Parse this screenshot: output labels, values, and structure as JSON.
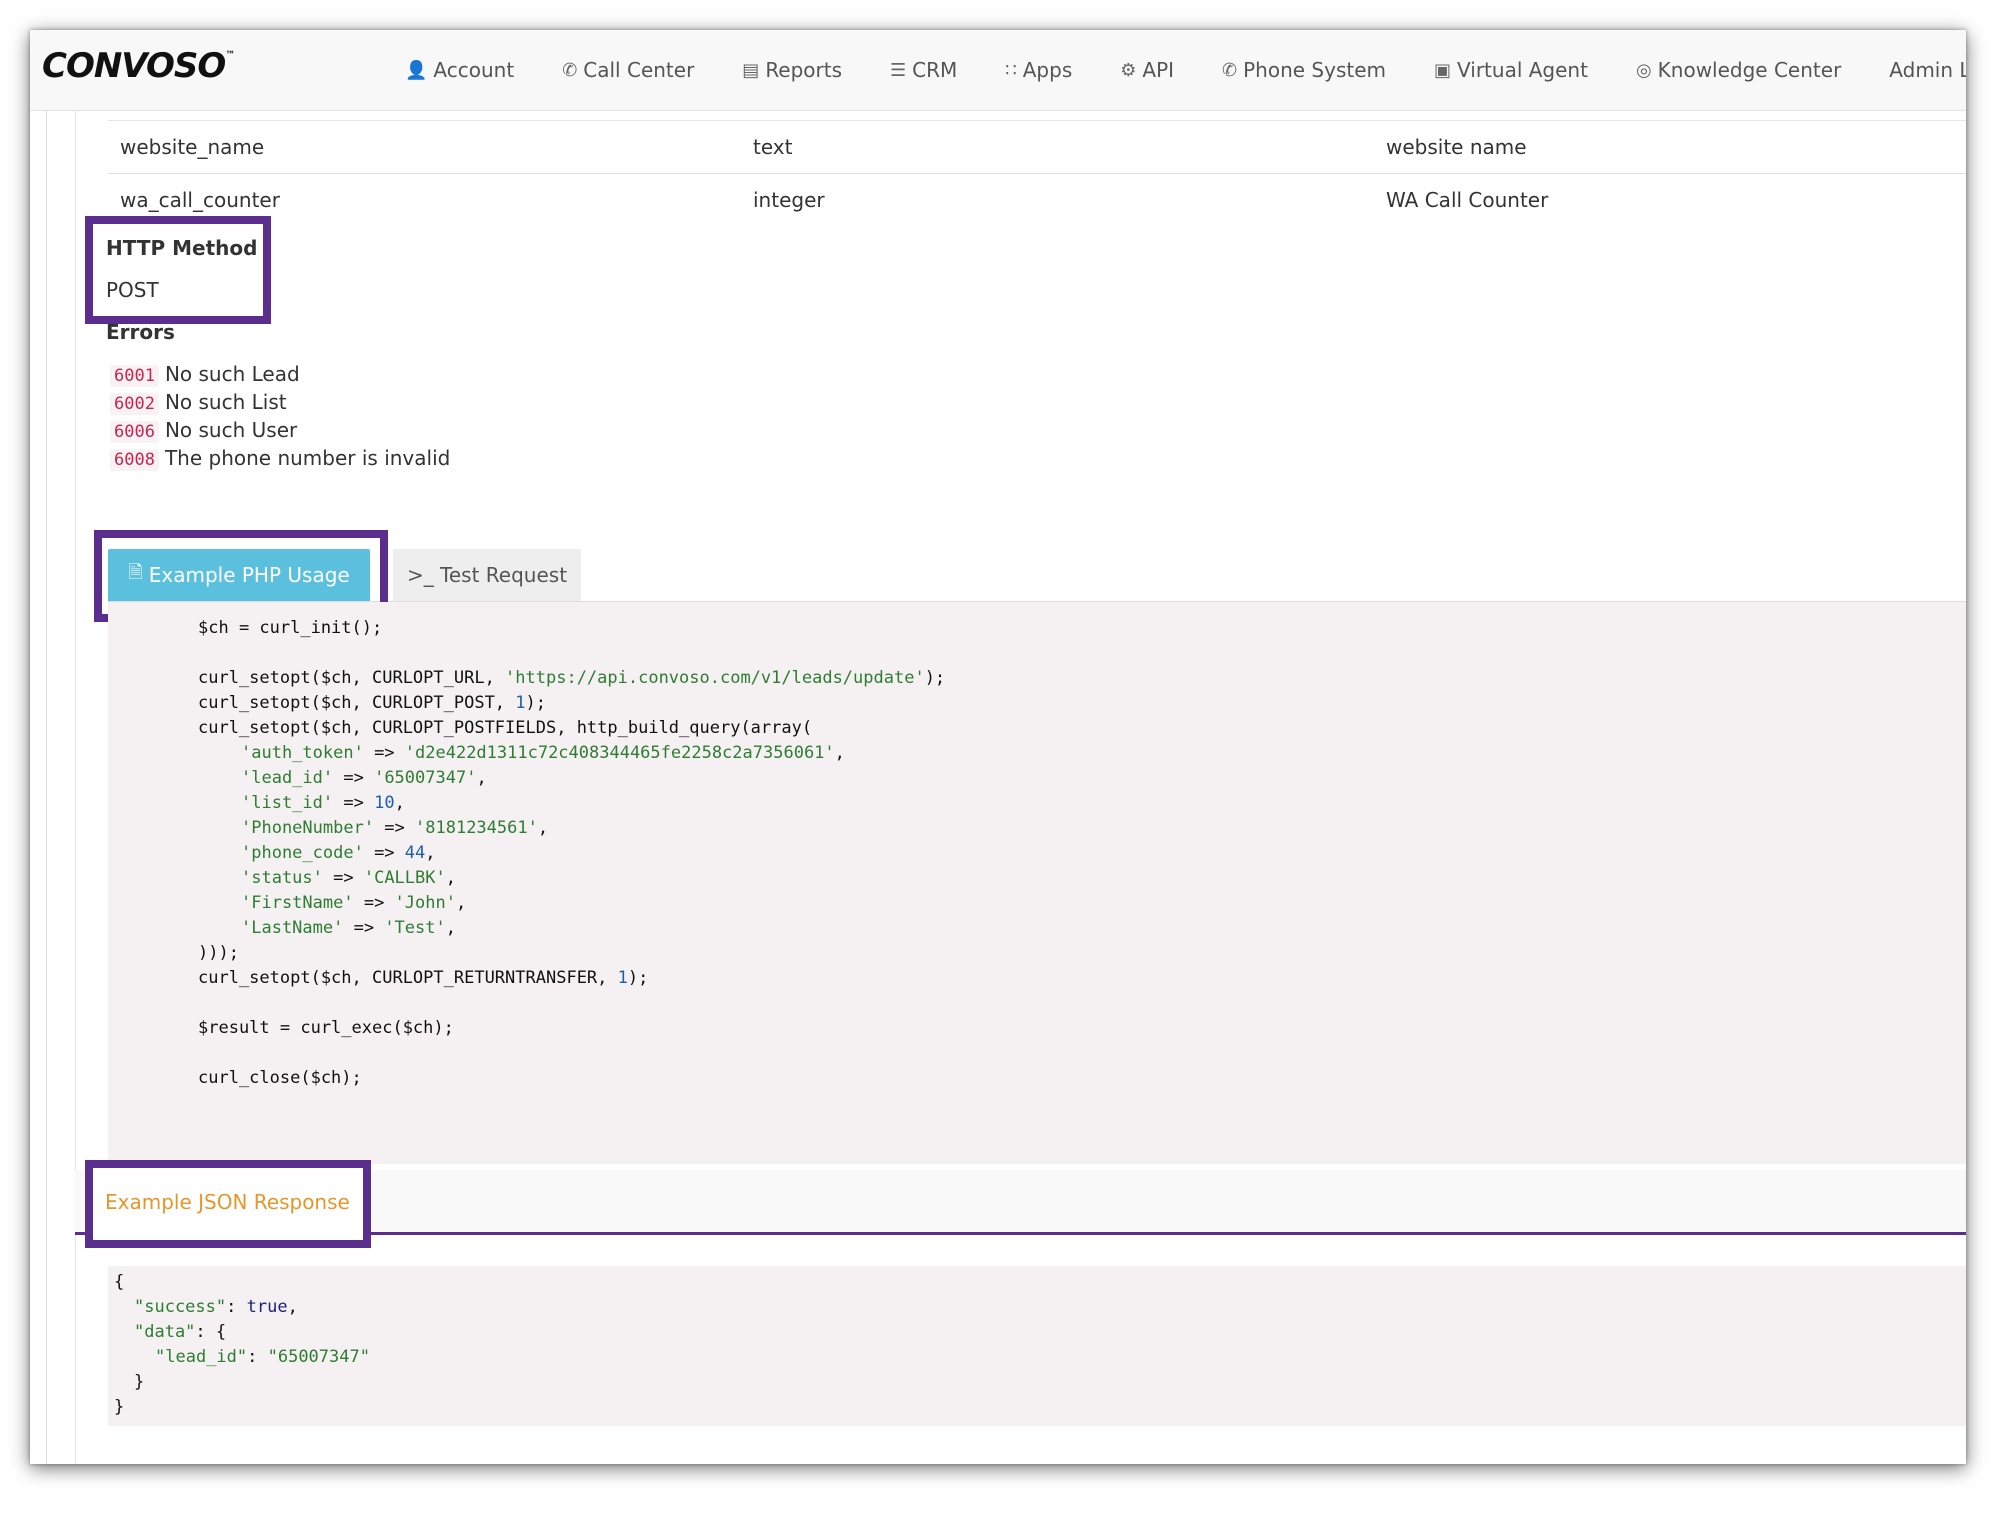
{
  "brand": {
    "logo": "CONVOSO",
    "trademark": "™"
  },
  "nav": [
    {
      "label": "Account",
      "icon": "user-icon"
    },
    {
      "label": "Call Center",
      "icon": "phone-icon"
    },
    {
      "label": "Reports",
      "icon": "bar-chart-icon"
    },
    {
      "label": "CRM",
      "icon": "list-icon"
    },
    {
      "label": "Apps",
      "icon": "grid-icon"
    },
    {
      "label": "API",
      "icon": "gear-icon"
    },
    {
      "label": "Phone System",
      "icon": "phone-icon"
    },
    {
      "label": "Virtual Agent",
      "icon": "monitor-icon"
    },
    {
      "label": "Knowledge Center",
      "icon": "lightbulb-icon"
    },
    {
      "label": "Admin Logs",
      "icon": ""
    }
  ],
  "params": [
    {
      "name": "website_name",
      "type": "text",
      "description": "website name"
    },
    {
      "name": "wa_call_counter",
      "type": "integer",
      "description": "WA Call Counter"
    }
  ],
  "http": {
    "label": "HTTP Method",
    "value": "POST"
  },
  "errors": {
    "label": "Errors",
    "items": [
      {
        "code": "6001",
        "message": "No such Lead"
      },
      {
        "code": "6002",
        "message": "No such List"
      },
      {
        "code": "6006",
        "message": "No such User"
      },
      {
        "code": "6008",
        "message": "The phone number is invalid"
      }
    ]
  },
  "tabs": {
    "php": "Example PHP Usage",
    "test": ">_ Test Request"
  },
  "php_code": {
    "init": "$ch = curl_init();",
    "url_fn": "curl_setopt($ch, CURLOPT_URL, ",
    "url": "'https://api.convoso.com/v1/leads/update'",
    "post_fn": "curl_setopt($ch, CURLOPT_POST, ",
    "post_val": "1",
    "fields_fn": "curl_setopt($ch, CURLOPT_POSTFIELDS, http_build_query(array(",
    "fields": [
      {
        "key": "'auth_token'",
        "value": "'d2e422d1311c72c408344465fe2258c2a7356061'",
        "kind": "str"
      },
      {
        "key": "'lead_id'",
        "value": "'65007347'",
        "kind": "str"
      },
      {
        "key": "'list_id'",
        "value": "10",
        "kind": "num"
      },
      {
        "key": "'PhoneNumber'",
        "value": "'8181234561'",
        "kind": "str"
      },
      {
        "key": "'phone_code'",
        "value": "44",
        "kind": "num"
      },
      {
        "key": "'status'",
        "value": "'CALLBK'",
        "kind": "str"
      },
      {
        "key": "'FirstName'",
        "value": "'John'",
        "kind": "str"
      },
      {
        "key": "'LastName'",
        "value": "'Test'",
        "kind": "str"
      }
    ],
    "close_array": ")));",
    "rt_fn": "curl_setopt($ch, CURLOPT_RETURNTRANSFER, ",
    "rt_val": "1",
    "exec": "$result = curl_exec($ch);",
    "close": "curl_close($ch);"
  },
  "json_response": {
    "title": "Example JSON Response",
    "open": "{",
    "success_key": "\"success\"",
    "success_val": "true",
    "data_key": "\"data\"",
    "lead_key": "\"lead_id\"",
    "lead_val": "\"65007347\"",
    "inner_close": "}",
    "close": "}"
  },
  "colors": {
    "accent": "#5b2d8c",
    "tab_active": "#5bc0de",
    "json_title": "#e8962c",
    "error_code": "#c7254e"
  }
}
